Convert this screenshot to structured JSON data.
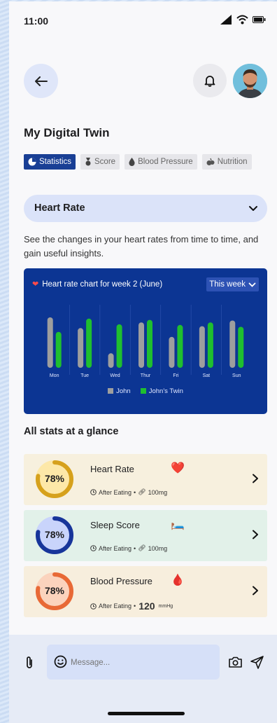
{
  "status_bar": {
    "time": "11:00"
  },
  "page": {
    "title": "My Digital Twin"
  },
  "tabs": [
    {
      "label": "Statistics",
      "icon": "pie-chart-icon",
      "active": true
    },
    {
      "label": "Score",
      "icon": "medal-icon",
      "active": false
    },
    {
      "label": "Blood Pressure",
      "icon": "droplet-icon",
      "active": false
    },
    {
      "label": "Nutrition",
      "icon": "nutrition-icon",
      "active": false
    }
  ],
  "metric_select": {
    "selected": "Heart Rate"
  },
  "description": "See the changes in your heart rates from time to time, and gain useful insights.",
  "chart_card": {
    "title": "Heart rate chart for week 2 (June)",
    "period": "This week"
  },
  "chart_data": {
    "type": "bar",
    "title": "Heart rate chart for week 2 (June)",
    "categories": [
      "Mon",
      "Tue",
      "Wed",
      "Thur",
      "Fri",
      "Sat",
      "Sun"
    ],
    "series": [
      {
        "name": "John",
        "values": [
          80,
          63,
          23,
          72,
          49,
          66,
          75
        ],
        "color": "#9e9e9e"
      },
      {
        "name": "John's Twin",
        "values": [
          57,
          78,
          69,
          76,
          68,
          72,
          65
        ],
        "color": "#1fbf2f"
      }
    ],
    "ylim": [
      0,
      100
    ],
    "grid": false,
    "legend": "bottom"
  },
  "section_title": "All stats at a glance",
  "stats": [
    {
      "name": "Heart Rate",
      "percent": "78%",
      "fraction": 0.78,
      "emoji": "❤️",
      "meta1": "After Eating",
      "meta2": "100mg",
      "bg": "#f7f0de",
      "ring_color": "#d6a11c",
      "fill": "#fde8a8"
    },
    {
      "name": "Sleep Score",
      "percent": "78%",
      "fraction": 0.78,
      "emoji": "🛏️",
      "meta1": "After Eating",
      "meta2": "100mg",
      "bg": "#e2f1e9",
      "ring_color": "#17359a",
      "fill": "#c9d4fb"
    },
    {
      "name": "Blood Pressure",
      "percent": "78%",
      "fraction": 0.78,
      "emoji": "🩸",
      "meta1": "After Eating",
      "meta2_value": "120",
      "meta2_unit": "mmHg",
      "bg": "#f7eedd",
      "ring_color": "#e86936",
      "fill": "#fbd3bd"
    }
  ],
  "composer": {
    "placeholder": "Message..."
  }
}
